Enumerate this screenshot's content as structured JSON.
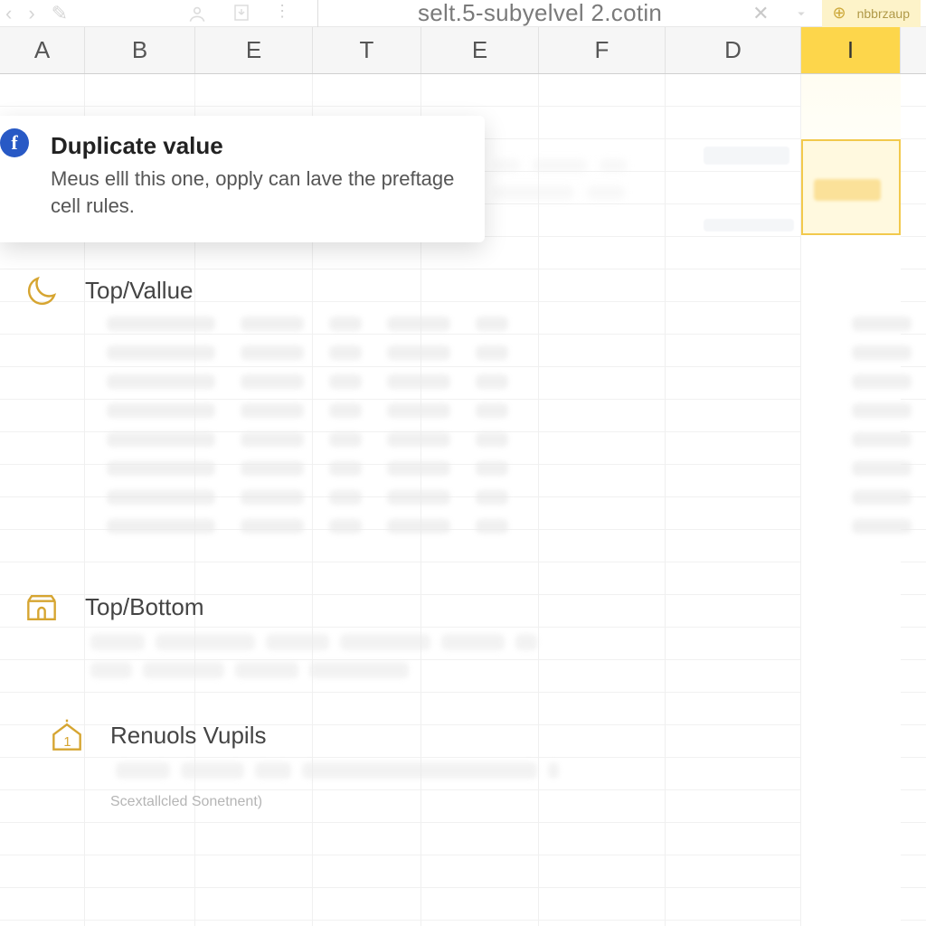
{
  "toolbar": {
    "url_text": "selt.5-subyelvel 2.cotin",
    "new_tab_label": "nbbrzaup"
  },
  "columns": [
    "A",
    "B",
    "E",
    "T",
    "E",
    "F",
    "D",
    "I"
  ],
  "active_column_index": 7,
  "popup": {
    "badge_letter": "f",
    "title": "Duplicate value",
    "body": "Meus elll this one, opply can lave the preftage cell rules."
  },
  "rules": {
    "top_value": {
      "title": "Top/Vallue"
    },
    "top_bottom": {
      "title": "Top/Bottom"
    },
    "renuols": {
      "title": "Renuols Vupils",
      "subcaption": "Scextallcled Sonetnent)"
    }
  }
}
